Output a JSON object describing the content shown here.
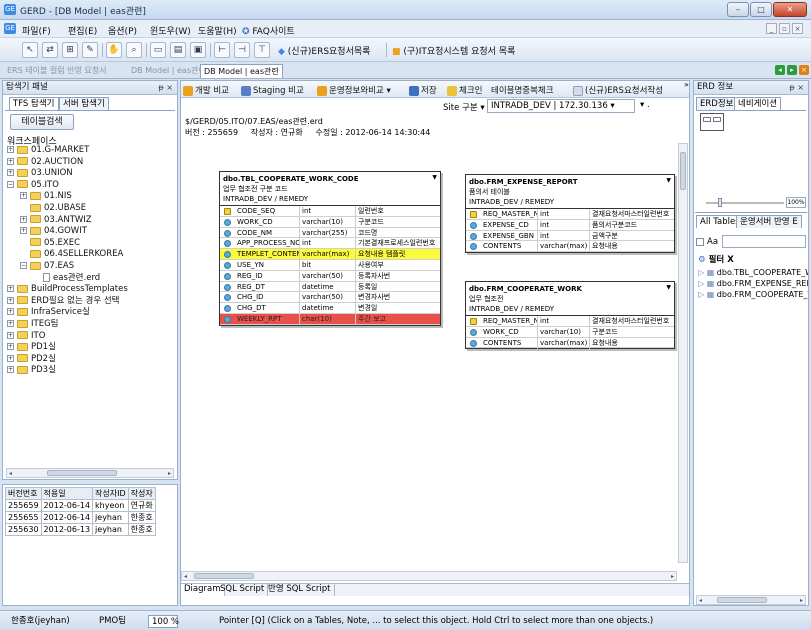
{
  "window": {
    "title": "GERD - [DB Model | eas관련]",
    "app_icon": "GE",
    "colors": {
      "accent": "#3d8be6",
      "highlight_yellow": "#fbfb3c",
      "highlight_red": "#e9504a"
    }
  },
  "menu": {
    "items": [
      "파일(F)",
      "편집(E)",
      "옵션(P)",
      "윈도우(W)",
      "도움말(H)",
      "FAQ사이트"
    ]
  },
  "toolbar1": {
    "link1": "(신규)ERS요청서목록",
    "link2": "(구)IT요청시스템 요청서 목록"
  },
  "doc_tabs": {
    "items": [
      "ERS 테이블 컬럼 반영 요청서",
      "DB Model | eas관련",
      "DB Model | eas관련"
    ]
  },
  "explorer": {
    "title": "탐색기 패널",
    "tabs": [
      "TFS 탐색기",
      "서버 탐색기"
    ],
    "search_button": "테이블검색",
    "workspace_label": "워크스페이스",
    "tree": [
      {
        "label": "01.G-MARKET",
        "level": 0,
        "expander": "+",
        "type": "folder"
      },
      {
        "label": "02.AUCTION",
        "level": 0,
        "expander": "+",
        "type": "folder"
      },
      {
        "label": "03.UNION",
        "level": 0,
        "expander": "+",
        "type": "folder"
      },
      {
        "label": "05.ITO",
        "level": 0,
        "expander": "−",
        "type": "folder"
      },
      {
        "label": "01.NIS",
        "level": 1,
        "expander": "+",
        "type": "folder"
      },
      {
        "label": "02.UBASE",
        "level": 1,
        "expander": "",
        "type": "folder"
      },
      {
        "label": "03.ANTWIZ",
        "level": 1,
        "expander": "+",
        "type": "folder"
      },
      {
        "label": "04.GOWIT",
        "level": 1,
        "expander": "+",
        "type": "folder"
      },
      {
        "label": "05.EXEC",
        "level": 1,
        "expander": "",
        "type": "folder"
      },
      {
        "label": "06.4SELLERKOREA",
        "level": 1,
        "expander": "",
        "type": "folder"
      },
      {
        "label": "07.EAS",
        "level": 1,
        "expander": "−",
        "type": "folder"
      },
      {
        "label": "eas관련.erd",
        "level": 2,
        "expander": "",
        "type": "file"
      },
      {
        "label": "BuildProcessTemplates",
        "level": 0,
        "expander": "+",
        "type": "folder"
      },
      {
        "label": "ERD필요 없는 경우 선택",
        "level": 0,
        "expander": "+",
        "type": "folder"
      },
      {
        "label": "InfraService실",
        "level": 0,
        "expander": "+",
        "type": "folder"
      },
      {
        "label": "ITEG팀",
        "level": 0,
        "expander": "+",
        "type": "folder"
      },
      {
        "label": "ITO",
        "level": 0,
        "expander": "+",
        "type": "folder"
      },
      {
        "label": "PD1실",
        "level": 0,
        "expander": "+",
        "type": "folder"
      },
      {
        "label": "PD2실",
        "level": 0,
        "expander": "+",
        "type": "folder"
      },
      {
        "label": "PD3실",
        "level": 0,
        "expander": "+",
        "type": "folder"
      }
    ]
  },
  "history": {
    "columns": [
      "버전번호",
      "적용일",
      "작성자ID",
      "작성자"
    ],
    "rows": [
      [
        "255659",
        "2012-06-14",
        "khyeon",
        "연규화"
      ],
      [
        "255655",
        "2012-06-14",
        "jeyhan",
        "한종호"
      ],
      [
        "255630",
        "2012-06-13",
        "jeyhan",
        "한종호"
      ]
    ]
  },
  "toolbar2": {
    "items": [
      "개발 비교",
      "Staging 비교",
      "운영정보와비교",
      "저장",
      "체크인",
      "테이블명중복체크",
      "(신규)ERS요청서작성"
    ]
  },
  "site": {
    "label": "Site 구분",
    "value": "INTRADB_DEV | 172.30.136",
    "second_value": ""
  },
  "file_info": {
    "path": "$/GERD/05.ITO/07.EAS/eas관련.erd",
    "version_label": "버전",
    "version": "255659",
    "author_label": "작성자",
    "author": "연규화",
    "modified_label": "수정일",
    "modified": "2012-06-14 14:30:44"
  },
  "entities": [
    {
      "name": "dbo.TBL_COOPERATE_WORK_CODE",
      "desc": "업무 협조전 구분 코드",
      "db": "INTRADB_DEV / REMEDY",
      "rows": [
        {
          "col": "CODE_SEQ",
          "type": "int",
          "comment": "일련번호",
          "key": "pk",
          "hl": ""
        },
        {
          "col": "WORK_CD",
          "type": "varchar(10)",
          "comment": "구분코드",
          "key": "col",
          "hl": ""
        },
        {
          "col": "CODE_NM",
          "type": "varchar(255)",
          "comment": "코드명",
          "key": "col",
          "hl": ""
        },
        {
          "col": "APP_PROCESS_NO",
          "type": "int",
          "comment": "기본결재프로세스일련번호",
          "key": "col",
          "hl": ""
        },
        {
          "col": "TEMPLET_CONTENTS",
          "type": "varchar(max)",
          "comment": "요청내용 템플릿",
          "key": "col",
          "hl": "yellow"
        },
        {
          "col": "USE_YN",
          "type": "bit",
          "comment": "사용여부",
          "key": "col",
          "hl": ""
        },
        {
          "col": "REG_ID",
          "type": "varchar(50)",
          "comment": "등록자사번",
          "key": "col",
          "hl": ""
        },
        {
          "col": "REG_DT",
          "type": "datetime",
          "comment": "등록일",
          "key": "col",
          "hl": ""
        },
        {
          "col": "CHG_ID",
          "type": "varchar(50)",
          "comment": "변경자사번",
          "key": "col",
          "hl": ""
        },
        {
          "col": "CHG_DT",
          "type": "datetime",
          "comment": "변경일",
          "key": "col",
          "hl": ""
        },
        {
          "col": "WEEKLY_RPT",
          "type": "char(10)",
          "comment": "주간 보고",
          "key": "col",
          "hl": "red"
        }
      ]
    },
    {
      "name": "dbo.FRM_EXPENSE_REPORT",
      "desc": "품의서 테이블",
      "db": "INTRADB_DEV / REMEDY",
      "rows": [
        {
          "col": "REQ_MASTER_NO",
          "type": "int",
          "comment": "결재요청서마스터일련번호",
          "key": "pk",
          "hl": ""
        },
        {
          "col": "EXPENSE_CD",
          "type": "int",
          "comment": "품의서구분코드",
          "key": "col",
          "hl": ""
        },
        {
          "col": "EXPENSE_GBN",
          "type": "int",
          "comment": "금액구분",
          "key": "col",
          "hl": ""
        },
        {
          "col": "CONTENTS",
          "type": "varchar(max)",
          "comment": "요청내용",
          "key": "col",
          "hl": ""
        }
      ]
    },
    {
      "name": "dbo.FRM_COOPERATE_WORK",
      "desc": "업무 협조전",
      "db": "INTRADB_DEV / REMEDY",
      "rows": [
        {
          "col": "REQ_MASTER_NO",
          "type": "int",
          "comment": "결재요청서마스터일련번호",
          "key": "pk",
          "hl": ""
        },
        {
          "col": "WORK_CD",
          "type": "varchar(10)",
          "comment": "구분코드",
          "key": "col",
          "hl": ""
        },
        {
          "col": "CONTENTS",
          "type": "varchar(max)",
          "comment": "요청내용",
          "key": "col",
          "hl": ""
        }
      ]
    }
  ],
  "bottom_tabs": [
    "Diagram",
    "SQL Script",
    "반영 SQL Script"
  ],
  "erd_info": {
    "title": "ERD 정보",
    "tabs": [
      "ERD정보",
      "네비게이션"
    ],
    "zoom_value": "100%"
  },
  "filter_panel": {
    "tabs": [
      "All Tables",
      "운영서버 반영 E"
    ],
    "checkbox_label": "Aa",
    "search_value": "",
    "filter_label": "필터 X",
    "items": [
      "dbo.TBL_COOPERATE_WOR",
      "dbo.FRM_EXPENSE_REPOR",
      "dbo.FRM_COOPERATE_WC"
    ]
  },
  "status": {
    "user": "한종호(jeyhan)",
    "team": "PMO팀",
    "zoom": "100 %",
    "hint": "Pointer [Q] (Click on a Tables, Note, ... to select this object. Hold Ctrl to select more than one objects.)"
  }
}
